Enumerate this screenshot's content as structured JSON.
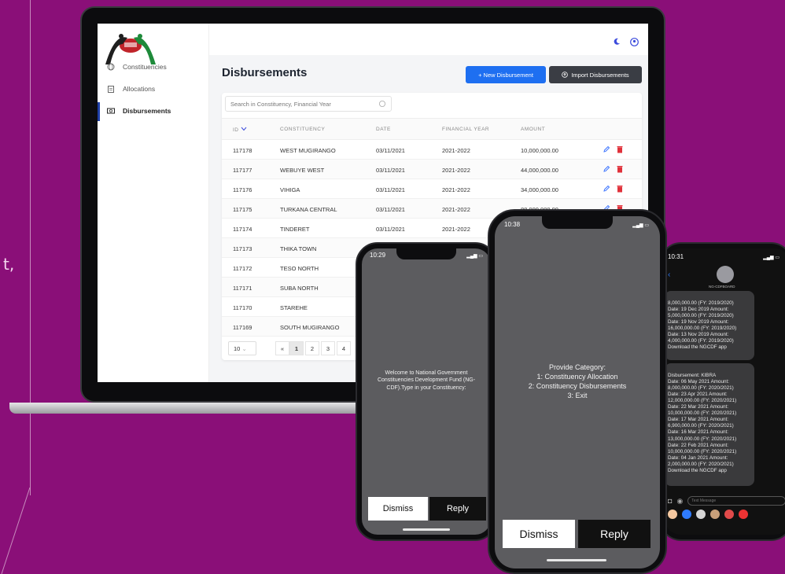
{
  "background_color": "#8a0f78",
  "side_text": "t,",
  "dashboard": {
    "sidebar": {
      "items": [
        {
          "label": "Constituencies",
          "icon": "globe-icon"
        },
        {
          "label": "Allocations",
          "icon": "clipboard-icon"
        },
        {
          "label": "Disbursements",
          "icon": "cash-icon"
        }
      ]
    },
    "header": {
      "title": "Disbursements"
    },
    "buttons": {
      "new_label": "+ New Disbursement",
      "import_label": "Import Disbursements"
    },
    "search": {
      "placeholder": "Search in Constituency, Financial Year"
    },
    "table": {
      "columns": [
        "ID",
        "CONSTITUENCY",
        "DATE",
        "FINANCIAL YEAR",
        "AMOUNT"
      ],
      "rows": [
        {
          "id": "117178",
          "constituency": "WEST MUGIRANGO",
          "date": "03/11/2021",
          "fy": "2021-2022",
          "amount": "10,000,000.00"
        },
        {
          "id": "117177",
          "constituency": "WEBUYE WEST",
          "date": "03/11/2021",
          "fy": "2021-2022",
          "amount": "44,000,000.00"
        },
        {
          "id": "117176",
          "constituency": "VIHIGA",
          "date": "03/11/2021",
          "fy": "2021-2022",
          "amount": "34,000,000.00"
        },
        {
          "id": "117175",
          "constituency": "TURKANA CENTRAL",
          "date": "03/11/2021",
          "fy": "2021-2022",
          "amount": "88,000,000.00"
        },
        {
          "id": "117174",
          "constituency": "TINDERET",
          "date": "03/11/2021",
          "fy": "2021-2022",
          "amount": ""
        },
        {
          "id": "117173",
          "constituency": "THIKA TOWN",
          "date": "",
          "fy": "",
          "amount": ""
        },
        {
          "id": "117172",
          "constituency": "TESO NORTH",
          "date": "",
          "fy": "",
          "amount": ""
        },
        {
          "id": "117171",
          "constituency": "SUBA NORTH",
          "date": "",
          "fy": "",
          "amount": ""
        },
        {
          "id": "117170",
          "constituency": "STAREHE",
          "date": "",
          "fy": "",
          "amount": ""
        },
        {
          "id": "117169",
          "constituency": "SOUTH MUGIRANGO",
          "date": "",
          "fy": "",
          "amount": ""
        }
      ]
    },
    "pagination": {
      "page_size": "10",
      "prev": "«",
      "pages": [
        "1",
        "2",
        "3",
        "4"
      ],
      "active_page": "1"
    }
  },
  "phone1": {
    "time": "10:29",
    "message": "Welcome to National Government Constituencies Development Fund (NG-CDF).Type in your Constituency:",
    "dismiss": "Dismiss",
    "reply": "Reply"
  },
  "phone2": {
    "time": "10:38",
    "message": "Provide Category:\n1: Constituency Allocation\n2: Constituency Disbursements\n3: Exit",
    "dismiss": "Dismiss",
    "reply": "Reply"
  },
  "phone3": {
    "time": "10:31",
    "sender": "NG-CDFBOARD",
    "bubble1": "8,000,000.00 (FY: 2019/2020)\nDate: 19 Dec 2019 Amount:\n5,000,000.00 (FY: 2019/2020)\nDate: 19 Nov 2019 Amount:\n16,000,000.00 (FY: 2019/2020)\nDate: 13 Nov 2019 Amount:\n4,000,000.00 (FY: 2019/2020)\n Download the NGCDF app",
    "bubble2": "Disbursement: KIBRA\nDate: 06 May 2021 Amount:\n8,000,000.00 (FY: 2020/2021)\nDate: 23 Apr 2021 Amount:\n12,000,000.00 (FY: 2020/2021)\nDate: 22 Mar 2021 Amount:\n10,000,000.00 (FY: 2020/2021)\nDate: 17 Mar 2021 Amount:\n6,900,000.00 (FY: 2020/2021)\nDate: 16 Mar 2021 Amount:\n13,000,000.00 (FY: 2020/2021)\nDate: 22 Feb 2021 Amount:\n10,000,000.00 (FY: 2020/2021)\nDate: 04 Jan 2021 Amount:\n2,000,000.00 (FY: 2020/2021)\n Download the NGCDF app",
    "input_placeholder": "Text Message"
  }
}
